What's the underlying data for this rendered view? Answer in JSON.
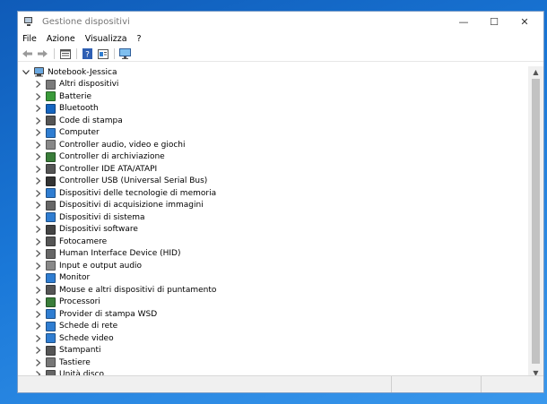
{
  "window": {
    "title": "Gestione dispositivi"
  },
  "window_controls": {
    "minimize": "—",
    "maximize": "☐",
    "close": "✕"
  },
  "menu": [
    {
      "label": "File"
    },
    {
      "label": "Azione"
    },
    {
      "label": "Visualizza"
    },
    {
      "label": "?"
    }
  ],
  "tree": {
    "root": "Notebook-Jessica",
    "items": [
      {
        "label": "Altri dispositivi",
        "icon": "unknown-device-icon",
        "color": "#7a7a7a"
      },
      {
        "label": "Batterie",
        "icon": "battery-icon",
        "color": "#3a9a3a"
      },
      {
        "label": "Bluetooth",
        "icon": "bluetooth-icon",
        "color": "#1565c0"
      },
      {
        "label": "Code di stampa",
        "icon": "print-queue-icon",
        "color": "#555555"
      },
      {
        "label": "Computer",
        "icon": "computer-icon",
        "color": "#2f7dd1"
      },
      {
        "label": "Controller audio, video e giochi",
        "icon": "speaker-icon",
        "color": "#888888"
      },
      {
        "label": "Controller di archiviazione",
        "icon": "storage-controller-icon",
        "color": "#3a7d3a"
      },
      {
        "label": "Controller IDE ATA/ATAPI",
        "icon": "ide-controller-icon",
        "color": "#555555"
      },
      {
        "label": "Controller USB (Universal Serial Bus)",
        "icon": "usb-icon",
        "color": "#333333"
      },
      {
        "label": "Dispositivi delle tecnologie di memoria",
        "icon": "memory-device-icon",
        "color": "#2f7dd1"
      },
      {
        "label": "Dispositivi di acquisizione immagini",
        "icon": "scanner-icon",
        "color": "#666666"
      },
      {
        "label": "Dispositivi di sistema",
        "icon": "system-device-icon",
        "color": "#2f7dd1"
      },
      {
        "label": "Dispositivi software",
        "icon": "software-device-icon",
        "color": "#444444"
      },
      {
        "label": "Fotocamere",
        "icon": "camera-icon",
        "color": "#555555"
      },
      {
        "label": "Human Interface Device (HID)",
        "icon": "hid-icon",
        "color": "#666666"
      },
      {
        "label": "Input e output audio",
        "icon": "audio-io-icon",
        "color": "#888888"
      },
      {
        "label": "Monitor",
        "icon": "monitor-icon",
        "color": "#2f7dd1"
      },
      {
        "label": "Mouse e altri dispositivi di puntamento",
        "icon": "mouse-icon",
        "color": "#555555"
      },
      {
        "label": "Processori",
        "icon": "processor-icon",
        "color": "#3a7d3a"
      },
      {
        "label": "Provider di stampa WSD",
        "icon": "wsd-printer-icon",
        "color": "#2f7dd1"
      },
      {
        "label": "Schede di rete",
        "icon": "network-adapter-icon",
        "color": "#2f7dd1"
      },
      {
        "label": "Schede video",
        "icon": "display-adapter-icon",
        "color": "#2f7dd1"
      },
      {
        "label": "Stampanti",
        "icon": "printer-icon",
        "color": "#555555"
      },
      {
        "label": "Tastiere",
        "icon": "keyboard-icon",
        "color": "#777777"
      },
      {
        "label": "Unità disco",
        "icon": "disk-drive-icon",
        "color": "#666666"
      }
    ]
  },
  "scrollbar": {
    "up": "▲",
    "down": "▼"
  }
}
